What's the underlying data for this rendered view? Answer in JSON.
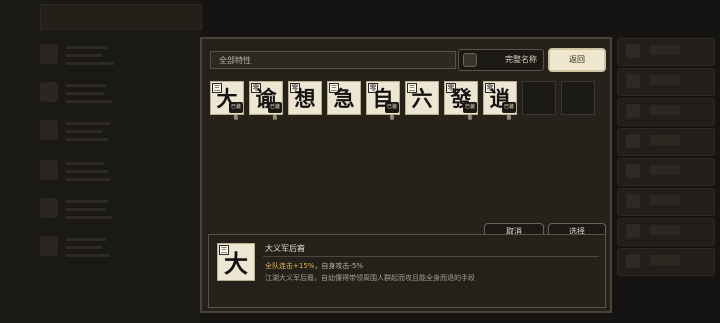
{
  "filter": {
    "label": "全部特性"
  },
  "fullname_toggle": {
    "label": "完整名称",
    "checked": false
  },
  "back_button": {
    "label": "返回"
  },
  "traits": [
    {
      "char": "大",
      "rank": "三",
      "stamp": "已装备"
    },
    {
      "char": "谕",
      "rank": "零",
      "stamp": "已装备"
    },
    {
      "char": "想",
      "rank": "零",
      "stamp": ""
    },
    {
      "char": "急",
      "rank": "三",
      "stamp": ""
    },
    {
      "char": "自",
      "rank": "零",
      "stamp": "已装备"
    },
    {
      "char": "六",
      "rank": "三",
      "stamp": ""
    },
    {
      "char": "發",
      "rank": "零",
      "stamp": "已装备"
    },
    {
      "char": "逍",
      "rank": "零",
      "stamp": "已装备"
    }
  ],
  "empty_slots": 2,
  "cancel_button": {
    "label": "取消"
  },
  "choose_button": {
    "label": "选择"
  },
  "detail": {
    "card_char": "大",
    "card_rank": "三",
    "name": "大义军后裔",
    "effect_highlight": "全队连击+15%",
    "effect_rest": "，自身攻击-5%",
    "description": "江湖大义军后裔，自幼懂得带领周围人群起而攻且能全身而退的手段"
  },
  "colors": {
    "accent": "#e3b54a",
    "card_bg": "#ece6d2",
    "modal_bg": "#26221b"
  }
}
